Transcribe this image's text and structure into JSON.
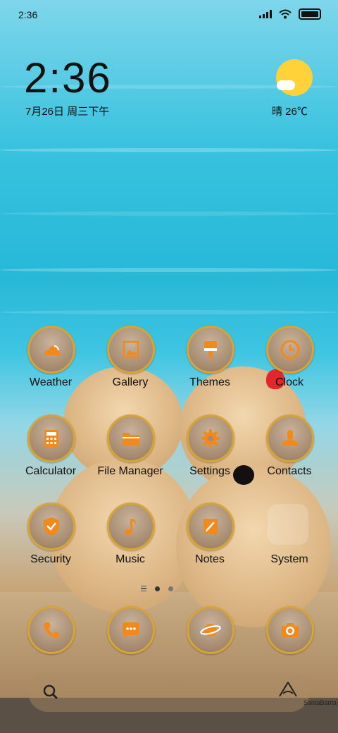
{
  "status_bar": {
    "time": "2:36",
    "signal": "signal-icon",
    "wifi": "wifi-icon",
    "battery": "battery-icon"
  },
  "clock_widget": {
    "time": "2:36",
    "date": "7月26日 周三下午"
  },
  "weather_widget": {
    "condition_icon": "sun-cloud-icon",
    "text": "晴 26℃"
  },
  "apps": [
    {
      "label": "Weather",
      "icon": "weather-icon"
    },
    {
      "label": "Gallery",
      "icon": "gallery-icon"
    },
    {
      "label": "Themes",
      "icon": "paintbrush-icon"
    },
    {
      "label": "Clock",
      "icon": "clock-icon"
    },
    {
      "label": "Calculator",
      "icon": "calculator-icon"
    },
    {
      "label": "File Manager",
      "icon": "folder-icon"
    },
    {
      "label": "Settings",
      "icon": "gear-icon"
    },
    {
      "label": "Contacts",
      "icon": "contact-icon"
    },
    {
      "label": "Security",
      "icon": "shield-icon"
    },
    {
      "label": "Music",
      "icon": "music-note-icon"
    },
    {
      "label": "Notes",
      "icon": "notes-icon"
    },
    {
      "label": "System",
      "icon": "folder-icon"
    }
  ],
  "dock": [
    {
      "icon": "phone-icon"
    },
    {
      "icon": "message-icon"
    },
    {
      "icon": "browser-icon"
    },
    {
      "icon": "camera-icon"
    }
  ],
  "page_indicator": {
    "pages": 2,
    "current": 1
  },
  "search_bar": {
    "icon": "search-icon"
  },
  "watermark": "SantaBanta",
  "colors": {
    "icon_glyph": "#f08a1c",
    "icon_ring": "#d7a437",
    "icon_bg": "#a58a6e"
  }
}
